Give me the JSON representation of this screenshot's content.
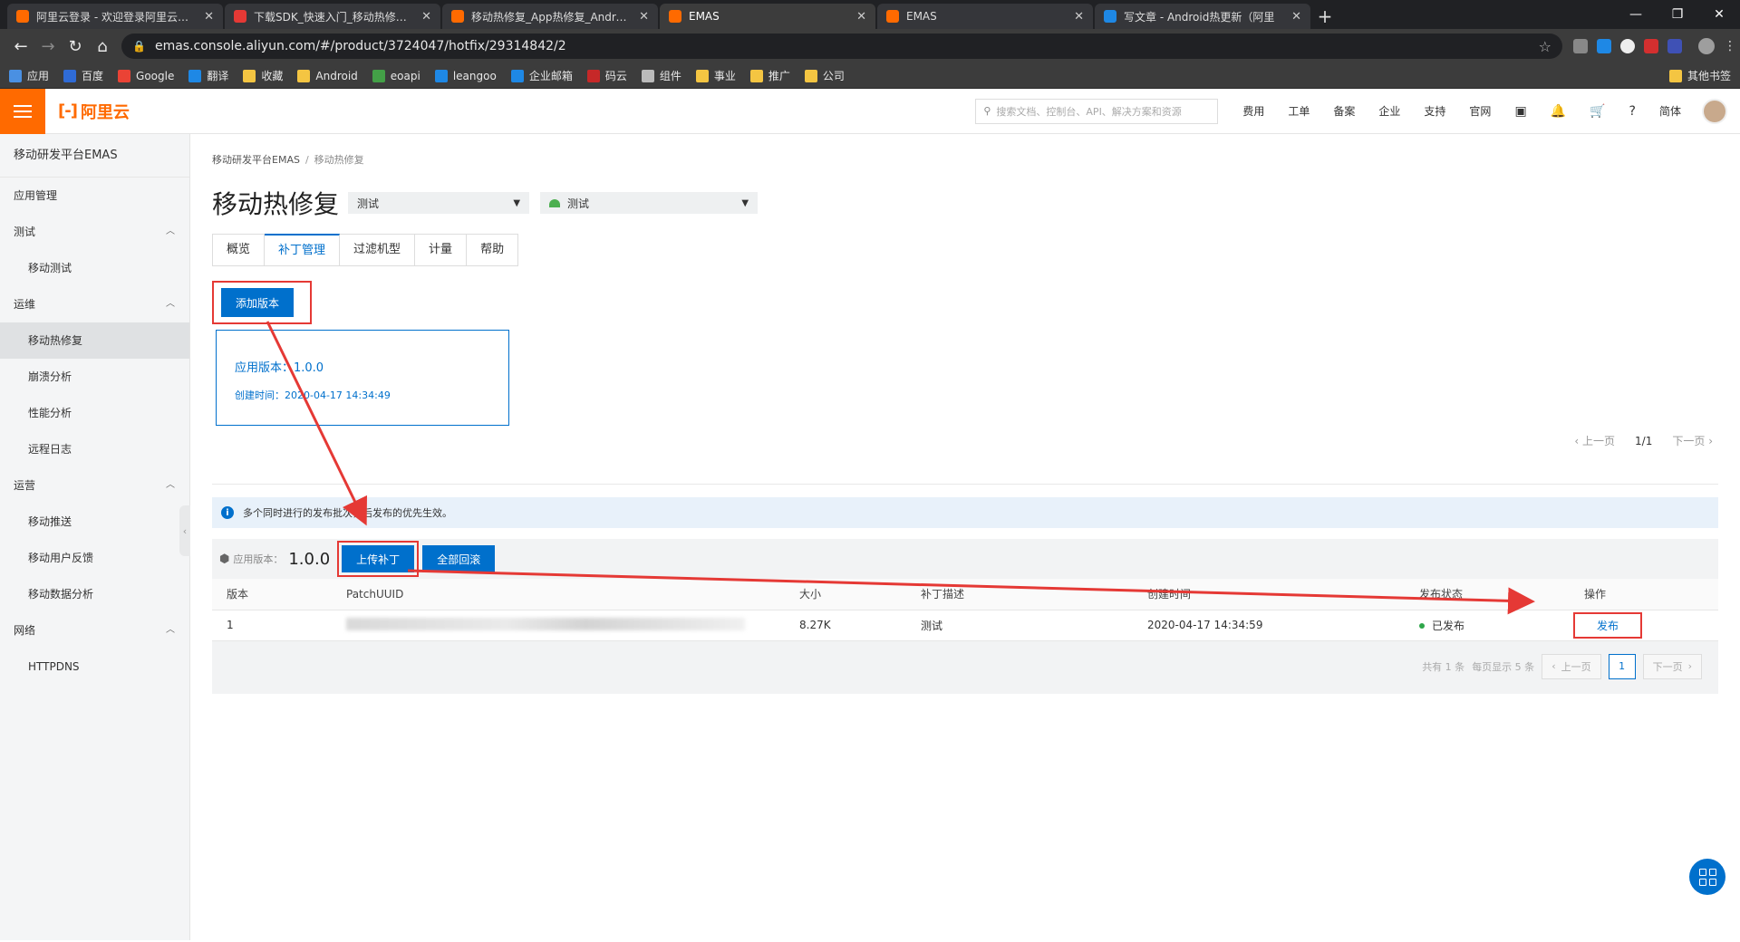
{
  "browser": {
    "tabs": [
      {
        "title": "阿里云登录 - 欢迎登录阿里云，安",
        "color": "#ff6a00"
      },
      {
        "title": "下载SDK_快速入门_移动热修复_App",
        "color": "#e53935"
      },
      {
        "title": "移动热修复_App热修复_Android",
        "color": "#ff6a00"
      },
      {
        "title": "EMAS",
        "color": "#ff6a00"
      },
      {
        "title": "EMAS",
        "color": "#ff6a00"
      },
      {
        "title": "写文章 - Android热更新（阿里",
        "color": "#1e88e5"
      }
    ],
    "url": "emas.console.aliyun.com/#/product/3724047/hotfix/29314842/2",
    "bookmarks": [
      {
        "label": "应用",
        "color": "#4a90e2"
      },
      {
        "label": "百度",
        "color": "#2f6bd6"
      },
      {
        "label": "Google",
        "color": "#ea4335"
      },
      {
        "label": "翻译",
        "color": "#1e88e5"
      },
      {
        "label": "收藏",
        "color": "#f4c542"
      },
      {
        "label": "Android",
        "color": "#f4c542"
      },
      {
        "label": "eoapi",
        "color": "#43a047"
      },
      {
        "label": "leangoo",
        "color": "#1e88e5"
      },
      {
        "label": "企业邮箱",
        "color": "#1e88e5"
      },
      {
        "label": "码云",
        "color": "#c62828"
      },
      {
        "label": "组件",
        "color": "#bbbbbb"
      },
      {
        "label": "事业",
        "color": "#f4c542"
      },
      {
        "label": "推广",
        "color": "#f4c542"
      },
      {
        "label": "公司",
        "color": "#f4c542"
      }
    ],
    "other_bookmarks": "其他书签"
  },
  "console": {
    "logo": "阿里云",
    "search_placeholder": "搜索文档、控制台、API、解决方案和资源",
    "nav": [
      "费用",
      "工单",
      "备案",
      "企业",
      "支持",
      "官网"
    ],
    "lang": "简体"
  },
  "sidebar": {
    "title": "移动研发平台EMAS",
    "items": [
      {
        "label": "应用管理",
        "type": "top"
      },
      {
        "label": "测试",
        "type": "group"
      },
      {
        "label": "移动测试",
        "type": "sub"
      },
      {
        "label": "运维",
        "type": "group"
      },
      {
        "label": "移动热修复",
        "type": "sub",
        "active": true
      },
      {
        "label": "崩溃分析",
        "type": "sub"
      },
      {
        "label": "性能分析",
        "type": "sub"
      },
      {
        "label": "远程日志",
        "type": "sub"
      },
      {
        "label": "运营",
        "type": "group"
      },
      {
        "label": "移动推送",
        "type": "sub"
      },
      {
        "label": "移动用户反馈",
        "type": "sub"
      },
      {
        "label": "移动数据分析",
        "type": "sub"
      },
      {
        "label": "网络",
        "type": "group"
      },
      {
        "label": "HTTPDNS",
        "type": "sub"
      }
    ]
  },
  "page": {
    "breadcrumb": [
      "移动研发平台EMAS",
      "移动热修复"
    ],
    "title": "移动热修复",
    "select_app": "测试",
    "select_platform": "测试",
    "tabs": [
      "概览",
      "补丁管理",
      "过滤机型",
      "计量",
      "帮助"
    ],
    "active_tab": 1,
    "add_version_label": "添加版本",
    "version_card": {
      "app_version": "应用版本：1.0.0",
      "created": "创建时间：2020-04-17 14:34:49"
    },
    "pager_top": {
      "prev": "上一页",
      "page": "1/1",
      "next": "下一页"
    },
    "notice": "多个同时进行的发布批次，后发布的优先生效。",
    "patch_toolbar": {
      "label": "应用版本：",
      "version": "1.0.0",
      "upload": "上传补丁",
      "rollback": "全部回滚"
    },
    "table": {
      "headers": [
        "版本",
        "PatchUUID",
        "大小",
        "补丁描述",
        "创建时间",
        "发布状态",
        "操作"
      ],
      "rows": [
        {
          "version": "1",
          "uuid": "",
          "size": "8.27K",
          "desc": "测试",
          "created": "2020-04-17 14:34:59",
          "status": "已发布",
          "action": "发布"
        }
      ]
    },
    "pager_bottom": {
      "total": "共有 1 条",
      "per_page": "每页显示 5 条",
      "prev": "上一页",
      "page": "1",
      "next": "下一页"
    }
  },
  "colors": {
    "brand": "#ff6a00",
    "primary": "#0070cc",
    "annotation": "#e53935"
  }
}
